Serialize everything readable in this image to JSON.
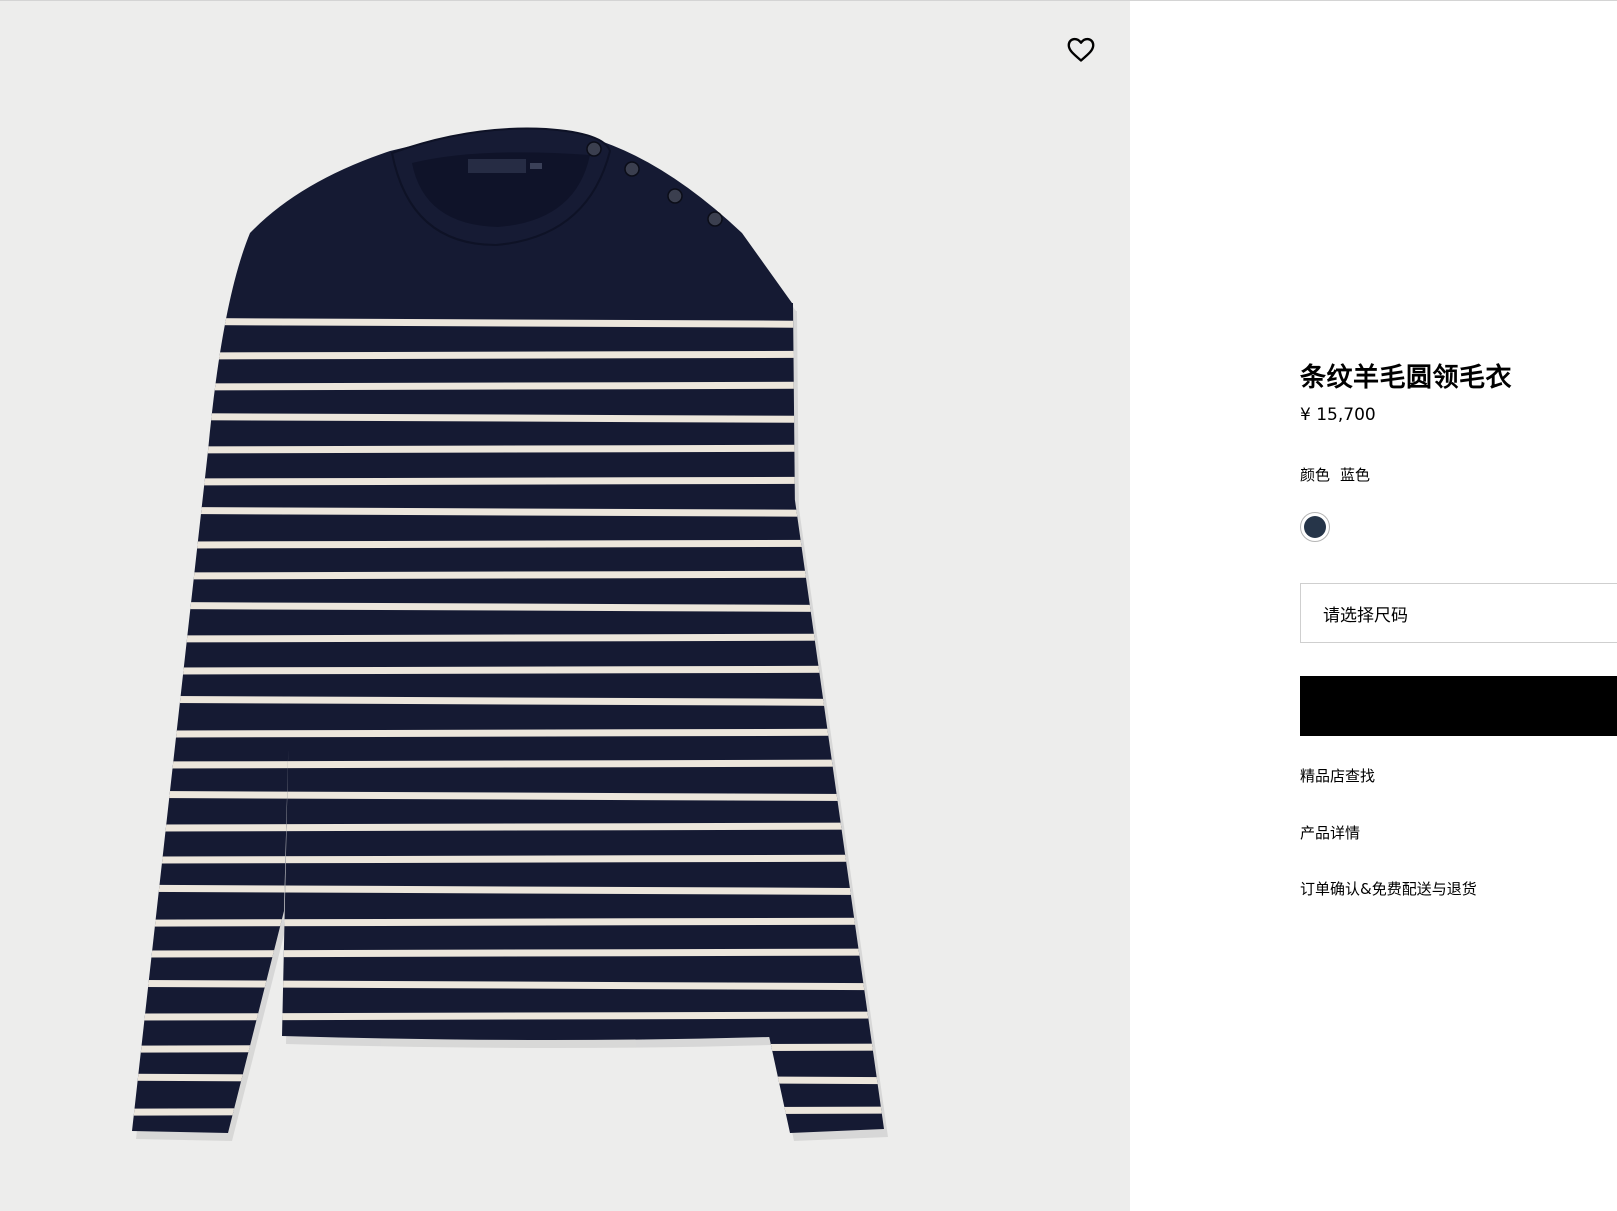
{
  "product": {
    "title": "条纹羊毛圆领毛衣",
    "price": "¥ 15,700",
    "color_label": "颜色",
    "color_value": "蓝色",
    "swatch_color": "#263549",
    "size_placeholder": "请选择尺码"
  },
  "links": {
    "find_boutique": "精品店查找",
    "details": "产品详情",
    "shipping": "订单确认&免费配送与退货"
  },
  "colors": {
    "gallery_background": "#ededec",
    "sweater_navy": "#151a33",
    "stripe_cream": "#ece6dc"
  },
  "icons": {
    "wishlist": "heart-outline-icon"
  }
}
